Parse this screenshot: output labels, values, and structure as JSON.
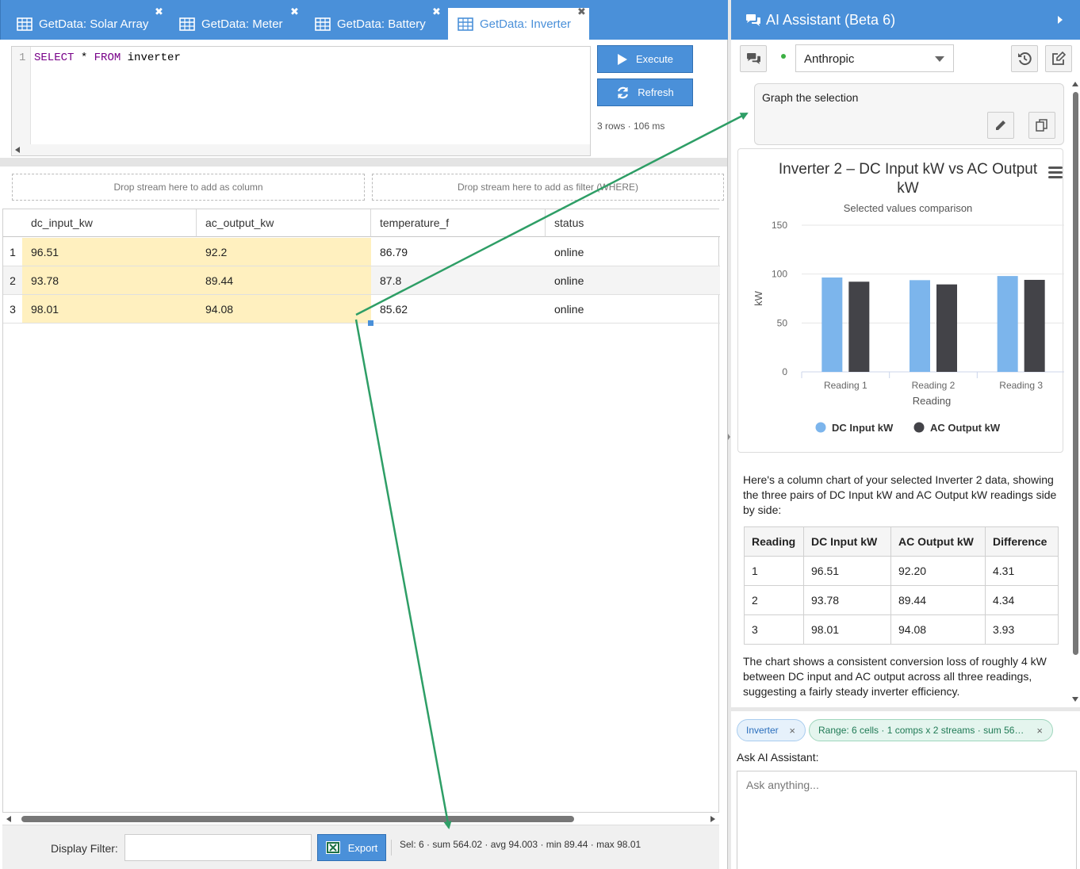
{
  "tabs": [
    {
      "label": "GetData: Solar Array",
      "active": false
    },
    {
      "label": "GetData: Meter",
      "active": false
    },
    {
      "label": "GetData: Battery",
      "active": false
    },
    {
      "label": "GetData: Inverter",
      "active": true
    }
  ],
  "editor": {
    "line_number": "1",
    "kw_select": "SELECT",
    "star": " * ",
    "kw_from": "FROM",
    "table": " inverter"
  },
  "actions": {
    "execute_label": "Execute",
    "refresh_label": "Refresh",
    "query_stats": "3 rows · 106 ms"
  },
  "dropzones": {
    "column": "Drop stream here to add as column",
    "filter": "Drop stream here to add as filter (WHERE)"
  },
  "grid": {
    "columns": [
      "dc_input_kw",
      "ac_output_kw",
      "temperature_f",
      "status"
    ],
    "rows": [
      {
        "n": "1",
        "cells": [
          "96.51",
          "92.2",
          "86.79",
          "online"
        ]
      },
      {
        "n": "2",
        "cells": [
          "93.78",
          "89.44",
          "87.8",
          "online"
        ]
      },
      {
        "n": "3",
        "cells": [
          "98.01",
          "94.08",
          "85.62",
          "online"
        ]
      }
    ]
  },
  "footer": {
    "filter_label": "Display Filter:",
    "filter_value": "",
    "export_label": "Export",
    "selection_stats": "Sel: 6 · sum 564.02 · avg 94.003 · min 89.44 · max 98.01"
  },
  "assistant": {
    "title": "AI Assistant (Beta 6)",
    "provider": "Anthropic",
    "user_message": "Graph the selection",
    "intro": "Here's a column chart of your selected Inverter 2 data, showing the three pairs of DC Input kW and AC Output kW readings side by side:",
    "table": {
      "headers": [
        "Reading",
        "DC Input kW",
        "AC Output kW",
        "Difference"
      ],
      "rows": [
        [
          "1",
          "96.51",
          "92.20",
          "4.31"
        ],
        [
          "2",
          "93.78",
          "89.44",
          "4.34"
        ],
        [
          "3",
          "98.01",
          "94.08",
          "3.93"
        ]
      ]
    },
    "outro": "The chart shows a consistent conversion loss of roughly 4 kW between DC input and AC output across all three readings, suggesting a fairly steady inverter efficiency.",
    "chips": [
      {
        "label": "Inverter"
      },
      {
        "label": "Range: 6 cells · 1 comps x 2 streams · sum 56…"
      }
    ],
    "ask_label": "Ask AI Assistant:",
    "ask_placeholder": "Ask anything..."
  },
  "colors": {
    "accent": "#4a90d9",
    "selection": "#fff0bf",
    "series_dc": "#7cb5ec",
    "series_ac": "#434348",
    "arrow": "#2e9e66",
    "chip_green": "#e4f5ee"
  },
  "chart_data": {
    "type": "bar",
    "title": "Inverter 2 – DC Input kW vs AC Output kW",
    "subtitle": "Selected values comparison",
    "categories": [
      "Reading 1",
      "Reading 2",
      "Reading 3"
    ],
    "series": [
      {
        "name": "DC Input kW",
        "values": [
          96.51,
          93.78,
          98.01
        ]
      },
      {
        "name": "AC Output kW",
        "values": [
          92.2,
          89.44,
          94.08
        ]
      }
    ],
    "xlabel": "Reading",
    "ylabel": "kW",
    "ylim": [
      0,
      150
    ],
    "yticks": [
      "0",
      "50",
      "100",
      "150"
    ],
    "grid": true,
    "legend": "bottom"
  }
}
